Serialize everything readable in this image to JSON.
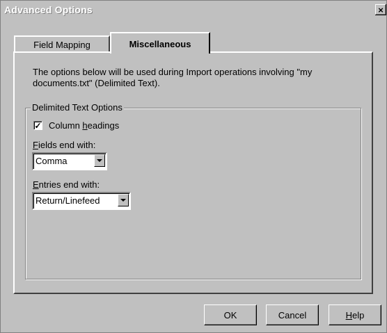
{
  "window": {
    "title": "Advanced Options",
    "close_glyph": "×"
  },
  "tabs": [
    {
      "label": "Field Mapping",
      "active": false
    },
    {
      "label": "Miscellaneous",
      "active": true
    }
  ],
  "description": "The options below will be used during Import operations involving \"my documents.txt\" (Delimited Text).",
  "group": {
    "title": "Delimited Text Options",
    "column_headings": {
      "checked": true,
      "label_pre": "Column ",
      "label_u": "h",
      "label_post": "eadings"
    },
    "fields_end": {
      "label_u": "F",
      "label_post": "ields end with:",
      "value": "Comma"
    },
    "entries_end": {
      "label_u": "E",
      "label_post": "ntries end with:",
      "value": "Return/Linefeed"
    }
  },
  "buttons": {
    "ok": "OK",
    "cancel": "Cancel",
    "help_u": "H",
    "help_post": "elp"
  }
}
